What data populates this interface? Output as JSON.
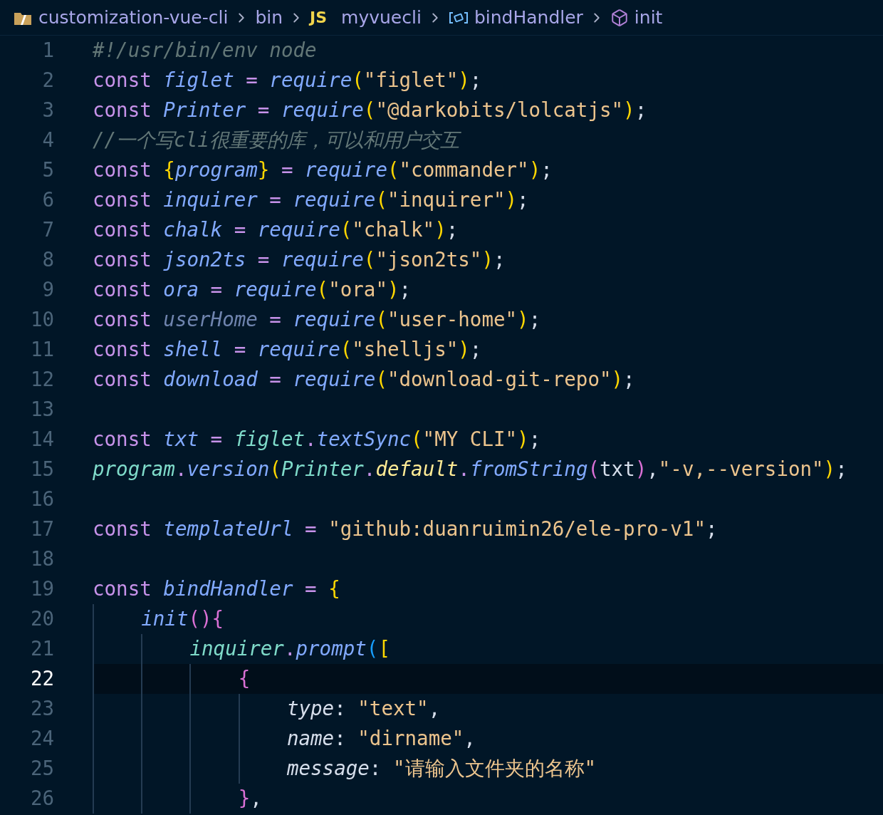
{
  "breadcrumb": [
    {
      "kind": "folder",
      "label": "customization-vue-cli"
    },
    {
      "kind": "plain",
      "label": "bin"
    },
    {
      "kind": "js",
      "badge": "JS",
      "label": "myvuecli"
    },
    {
      "kind": "variable",
      "label": "bindHandler"
    },
    {
      "kind": "method",
      "label": "init"
    }
  ],
  "lines": [
    {
      "number": "1",
      "current": false,
      "tokens": [
        {
          "text": "#!/usr/bin/env node",
          "kind": "comment"
        }
      ]
    },
    {
      "number": "2",
      "current": false,
      "tokens": [
        {
          "text": "const ",
          "kind": "keyword"
        },
        {
          "text": "figlet",
          "kind": "variable"
        },
        {
          "text": " = ",
          "kind": "operator"
        },
        {
          "text": "require",
          "kind": "function"
        },
        {
          "text": "(",
          "kind": "bracket1"
        },
        {
          "text": "\"figlet\"",
          "kind": "string"
        },
        {
          "text": ")",
          "kind": "bracket1"
        },
        {
          "text": ";",
          "kind": "punct"
        }
      ]
    },
    {
      "number": "3",
      "current": false,
      "tokens": [
        {
          "text": "const ",
          "kind": "keyword"
        },
        {
          "text": "Printer",
          "kind": "variable"
        },
        {
          "text": " = ",
          "kind": "operator"
        },
        {
          "text": "require",
          "kind": "function"
        },
        {
          "text": "(",
          "kind": "bracket1"
        },
        {
          "text": "\"@darkobits/lolcatjs\"",
          "kind": "string"
        },
        {
          "text": ")",
          "kind": "bracket1"
        },
        {
          "text": ";",
          "kind": "punct"
        }
      ]
    },
    {
      "number": "4",
      "current": false,
      "tokens": [
        {
          "text": "//一个写cli很重要的库，可以和用户交互",
          "kind": "comment"
        }
      ]
    },
    {
      "number": "5",
      "current": false,
      "tokens": [
        {
          "text": "const ",
          "kind": "keyword"
        },
        {
          "text": "{",
          "kind": "bracket1"
        },
        {
          "text": "program",
          "kind": "variable"
        },
        {
          "text": "}",
          "kind": "bracket1"
        },
        {
          "text": " = ",
          "kind": "operator"
        },
        {
          "text": "require",
          "kind": "function"
        },
        {
          "text": "(",
          "kind": "bracket1"
        },
        {
          "text": "\"commander\"",
          "kind": "string"
        },
        {
          "text": ")",
          "kind": "bracket1"
        },
        {
          "text": ";",
          "kind": "punct"
        }
      ]
    },
    {
      "number": "6",
      "current": false,
      "tokens": [
        {
          "text": "const ",
          "kind": "keyword"
        },
        {
          "text": "inquirer",
          "kind": "variable"
        },
        {
          "text": " = ",
          "kind": "operator"
        },
        {
          "text": "require",
          "kind": "function"
        },
        {
          "text": "(",
          "kind": "bracket1"
        },
        {
          "text": "\"inquirer\"",
          "kind": "string"
        },
        {
          "text": ")",
          "kind": "bracket1"
        },
        {
          "text": ";",
          "kind": "punct"
        }
      ]
    },
    {
      "number": "7",
      "current": false,
      "tokens": [
        {
          "text": "const ",
          "kind": "keyword"
        },
        {
          "text": "chalk",
          "kind": "variable"
        },
        {
          "text": " = ",
          "kind": "operator"
        },
        {
          "text": "require",
          "kind": "function"
        },
        {
          "text": "(",
          "kind": "bracket1"
        },
        {
          "text": "\"chalk\"",
          "kind": "string"
        },
        {
          "text": ")",
          "kind": "bracket1"
        },
        {
          "text": ";",
          "kind": "punct"
        }
      ]
    },
    {
      "number": "8",
      "current": false,
      "tokens": [
        {
          "text": "const ",
          "kind": "keyword"
        },
        {
          "text": "json2ts",
          "kind": "variable"
        },
        {
          "text": " = ",
          "kind": "operator"
        },
        {
          "text": "require",
          "kind": "function"
        },
        {
          "text": "(",
          "kind": "bracket1"
        },
        {
          "text": "\"json2ts\"",
          "kind": "string"
        },
        {
          "text": ")",
          "kind": "bracket1"
        },
        {
          "text": ";",
          "kind": "punct"
        }
      ]
    },
    {
      "number": "9",
      "current": false,
      "tokens": [
        {
          "text": "const ",
          "kind": "keyword"
        },
        {
          "text": "ora",
          "kind": "variable"
        },
        {
          "text": " = ",
          "kind": "operator"
        },
        {
          "text": "require",
          "kind": "function"
        },
        {
          "text": "(",
          "kind": "bracket1"
        },
        {
          "text": "\"ora\"",
          "kind": "string"
        },
        {
          "text": ")",
          "kind": "bracket1"
        },
        {
          "text": ";",
          "kind": "punct"
        }
      ]
    },
    {
      "number": "10",
      "current": false,
      "tokens": [
        {
          "text": "const ",
          "kind": "keyword"
        },
        {
          "text": "userHome",
          "kind": "unused"
        },
        {
          "text": " = ",
          "kind": "operator"
        },
        {
          "text": "require",
          "kind": "function"
        },
        {
          "text": "(",
          "kind": "bracket1"
        },
        {
          "text": "\"user-home\"",
          "kind": "string"
        },
        {
          "text": ")",
          "kind": "bracket1"
        },
        {
          "text": ";",
          "kind": "punct"
        }
      ]
    },
    {
      "number": "11",
      "current": false,
      "tokens": [
        {
          "text": "const ",
          "kind": "keyword"
        },
        {
          "text": "shell",
          "kind": "variable"
        },
        {
          "text": " = ",
          "kind": "operator"
        },
        {
          "text": "require",
          "kind": "function"
        },
        {
          "text": "(",
          "kind": "bracket1"
        },
        {
          "text": "\"shelljs\"",
          "kind": "string"
        },
        {
          "text": ")",
          "kind": "bracket1"
        },
        {
          "text": ";",
          "kind": "punct"
        }
      ]
    },
    {
      "number": "12",
      "current": false,
      "tokens": [
        {
          "text": "const ",
          "kind": "keyword"
        },
        {
          "text": "download",
          "kind": "variable"
        },
        {
          "text": " = ",
          "kind": "operator"
        },
        {
          "text": "require",
          "kind": "function"
        },
        {
          "text": "(",
          "kind": "bracket1"
        },
        {
          "text": "\"download-git-repo\"",
          "kind": "string"
        },
        {
          "text": ")",
          "kind": "bracket1"
        },
        {
          "text": ";",
          "kind": "punct"
        }
      ]
    },
    {
      "number": "13",
      "current": false
    },
    {
      "number": "14",
      "current": false,
      "tokens": [
        {
          "text": "const ",
          "kind": "keyword"
        },
        {
          "text": "txt",
          "kind": "variable"
        },
        {
          "text": " = ",
          "kind": "operator"
        },
        {
          "text": "figlet",
          "kind": "object"
        },
        {
          "text": ".",
          "kind": "operator"
        },
        {
          "text": "textSync",
          "kind": "function"
        },
        {
          "text": "(",
          "kind": "bracket1"
        },
        {
          "text": "\"MY CLI\"",
          "kind": "string"
        },
        {
          "text": ")",
          "kind": "bracket1"
        },
        {
          "text": ";",
          "kind": "punct"
        }
      ]
    },
    {
      "number": "15",
      "current": false,
      "tokens": [
        {
          "text": "program",
          "kind": "object"
        },
        {
          "text": ".",
          "kind": "operator"
        },
        {
          "text": "version",
          "kind": "function"
        },
        {
          "text": "(",
          "kind": "bracket1"
        },
        {
          "text": "Printer",
          "kind": "object"
        },
        {
          "text": ".",
          "kind": "operator"
        },
        {
          "text": "default",
          "kind": "property"
        },
        {
          "text": ".",
          "kind": "operator"
        },
        {
          "text": "fromString",
          "kind": "function"
        },
        {
          "text": "(",
          "kind": "bracket2"
        },
        {
          "text": "txt",
          "kind": "plain"
        },
        {
          "text": ")",
          "kind": "bracket2"
        },
        {
          "text": ",",
          "kind": "punct"
        },
        {
          "text": "\"-v,--version\"",
          "kind": "string"
        },
        {
          "text": ")",
          "kind": "bracket1"
        },
        {
          "text": ";",
          "kind": "punct"
        }
      ]
    },
    {
      "number": "16",
      "current": false
    },
    {
      "number": "17",
      "current": false,
      "tokens": [
        {
          "text": "const ",
          "kind": "keyword"
        },
        {
          "text": "templateUrl",
          "kind": "variable"
        },
        {
          "text": " = ",
          "kind": "operator"
        },
        {
          "text": "\"github:duanruimin26/ele-pro-v1\"",
          "kind": "string"
        },
        {
          "text": ";",
          "kind": "punct"
        }
      ]
    },
    {
      "number": "18",
      "current": false
    },
    {
      "number": "19",
      "current": false,
      "tokens": [
        {
          "text": "const ",
          "kind": "keyword"
        },
        {
          "text": "bindHandler",
          "kind": "variable"
        },
        {
          "text": " = ",
          "kind": "operator"
        },
        {
          "text": "{",
          "kind": "bracket1"
        }
      ]
    },
    {
      "number": "20",
      "current": false,
      "tokens": [
        {
          "text": "    init",
          "kind": "function"
        },
        {
          "text": "()",
          "kind": "bracket2"
        },
        {
          "text": "{",
          "kind": "bracket2"
        }
      ]
    },
    {
      "number": "21",
      "current": false,
      "tokens": [
        {
          "text": "        inquirer",
          "kind": "object"
        },
        {
          "text": ".",
          "kind": "operator"
        },
        {
          "text": "prompt",
          "kind": "function"
        },
        {
          "text": "(",
          "kind": "bracket3"
        },
        {
          "text": "[",
          "kind": "bracket1"
        }
      ]
    },
    {
      "number": "22",
      "current": true,
      "tokens": [
        {
          "text": "            {",
          "kind": "bracket2"
        }
      ]
    },
    {
      "number": "23",
      "current": false,
      "tokens": [
        {
          "text": "                type",
          "kind": "key"
        },
        {
          "text": ": ",
          "kind": "punct"
        },
        {
          "text": "\"text\"",
          "kind": "string"
        },
        {
          "text": ",",
          "kind": "punct"
        }
      ]
    },
    {
      "number": "24",
      "current": false,
      "tokens": [
        {
          "text": "                name",
          "kind": "key"
        },
        {
          "text": ": ",
          "kind": "punct"
        },
        {
          "text": "\"dirname\"",
          "kind": "string"
        },
        {
          "text": ",",
          "kind": "punct"
        }
      ]
    },
    {
      "number": "25",
      "current": false,
      "tokens": [
        {
          "text": "                message",
          "kind": "key"
        },
        {
          "text": ": ",
          "kind": "punct"
        },
        {
          "text": "\"请输入文件夹的名称\"",
          "kind": "string"
        }
      ]
    },
    {
      "number": "26",
      "current": false,
      "tokens": [
        {
          "text": "            }",
          "kind": "bracket2"
        },
        {
          "text": ",",
          "kind": "punct"
        }
      ]
    }
  ]
}
